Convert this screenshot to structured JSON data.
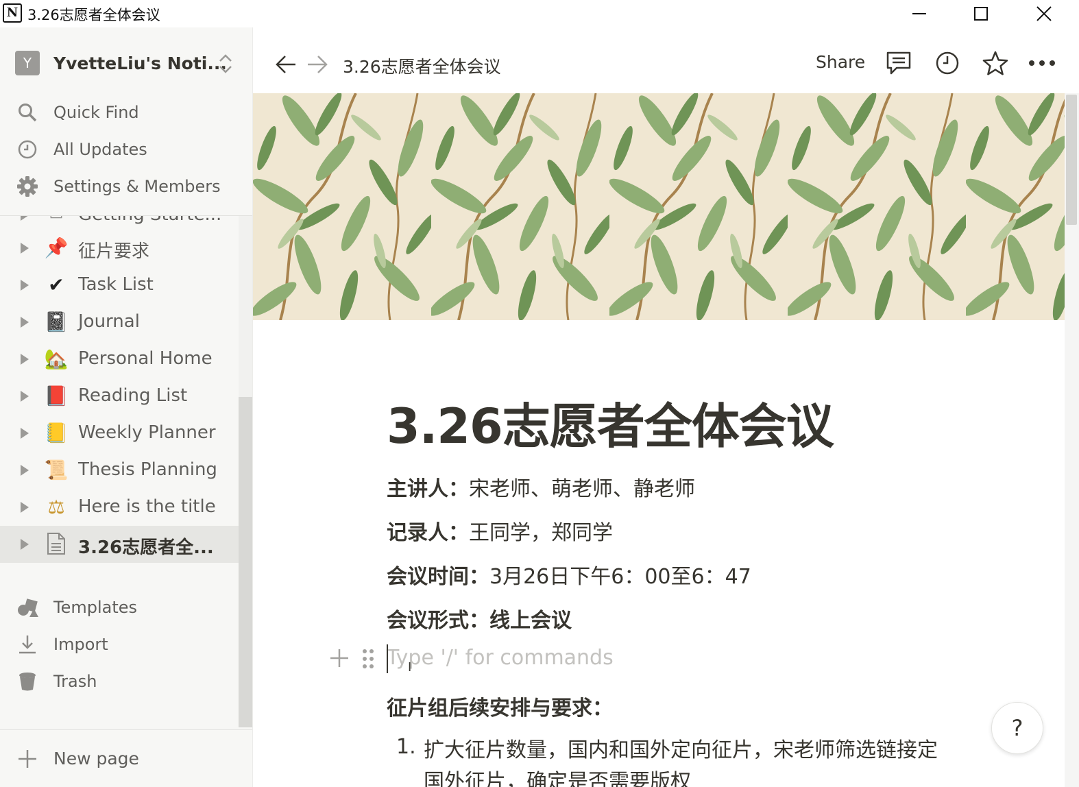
{
  "window": {
    "title": "3.26志愿者全体会议",
    "app_icon": "N"
  },
  "sidebar": {
    "workspace": {
      "avatar": "Y",
      "name": "YvetteLiu's Noti..."
    },
    "nav": [
      {
        "label": "Quick Find",
        "icon": "search-icon"
      },
      {
        "label": "All Updates",
        "icon": "clock-icon"
      },
      {
        "label": "Settings & Members",
        "icon": "gear-icon"
      }
    ],
    "partial_page": "Getting Starte...",
    "pages": [
      {
        "icon": "📌",
        "label": "征片要求"
      },
      {
        "icon": "✔",
        "label": "Task List"
      },
      {
        "icon": "📓",
        "label": "Journal"
      },
      {
        "icon": "🏡",
        "label": "Personal Home"
      },
      {
        "icon": "📕",
        "label": "Reading List"
      },
      {
        "icon": "📒",
        "label": "Weekly Planner"
      },
      {
        "icon": "📜",
        "label": "Thesis Planning"
      },
      {
        "icon": "⚖",
        "label": "Here is the title"
      },
      {
        "icon": "📄",
        "label": "3.26志愿者全...",
        "selected": true
      }
    ],
    "footer": [
      {
        "label": "Templates",
        "icon": "templates-icon"
      },
      {
        "label": "Import",
        "icon": "import-icon"
      },
      {
        "label": "Trash",
        "icon": "trash-icon"
      }
    ],
    "new_page": "New page"
  },
  "topbar": {
    "breadcrumb": "3.26志愿者全体会议",
    "share": "Share"
  },
  "page": {
    "title": "3.26志愿者全体会议",
    "props": [
      {
        "key": "主讲人：",
        "value": "宋老师、萌老师、静老师"
      },
      {
        "key": "记录人：",
        "value": "王同学，郑同学"
      },
      {
        "key": "会议时间：",
        "value": "3月26日下午6：00至6：47"
      },
      {
        "key": "会议形式：",
        "value": "线上会议",
        "bold_value": true
      }
    ],
    "placeholder": "Type '/' for commands",
    "section": "征片组后续安排与要求：",
    "list": [
      {
        "num": "1.",
        "text": "扩大征片数量，国内和国外定向征片，宋老师筛选链接定国外征片，确定是否需要版权"
      }
    ]
  },
  "help": "?"
}
